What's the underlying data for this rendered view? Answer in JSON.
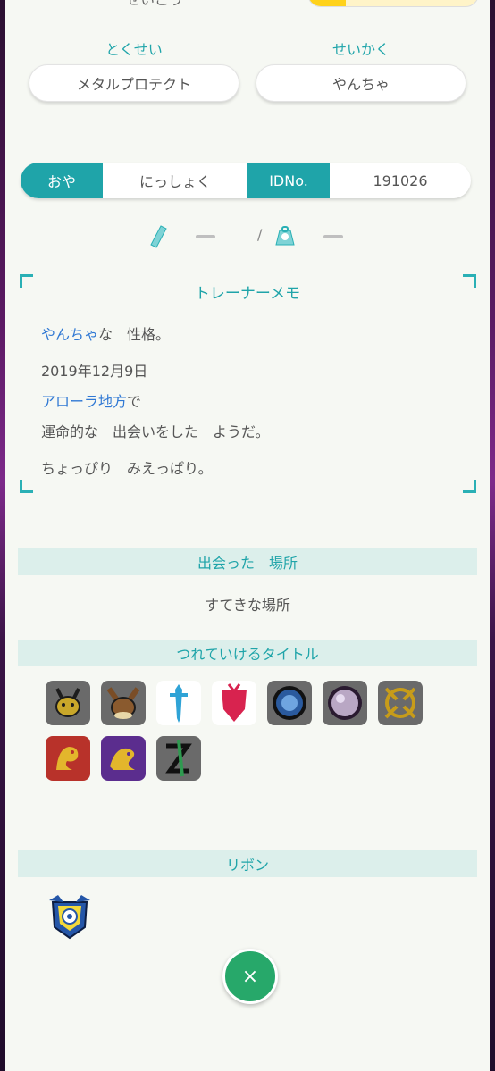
{
  "top": {
    "cut_label": "せいこう"
  },
  "ability": {
    "label": "とくせい",
    "value": "メタルプロテクト"
  },
  "nature": {
    "label": "せいかく",
    "value": "やんちゃ"
  },
  "trainer": {
    "ot_label": "おや",
    "ot_value": "にっしょく",
    "id_label": "IDNo.",
    "id_value": "191026"
  },
  "size": {
    "height": "—",
    "separator": "/",
    "weight": "—"
  },
  "memo": {
    "title": "トレーナーメモ",
    "nature_highlight": "やんちゃ",
    "nature_rest": "な　性格。",
    "date": "2019年12月9日",
    "region_highlight": "アローラ地方",
    "region_rest": "で",
    "met_line": "運命的な　出会いをした　ようだ。",
    "characteristic": "ちょっぴり　みえっぱり。"
  },
  "met_location": {
    "header": "出会った　場所",
    "value": "すてきな場所"
  },
  "titles": {
    "header": "つれていけるタイトル",
    "icons": [
      "pikachu-icon",
      "eevee-icon",
      "sword-icon",
      "shield-icon",
      "crystal-orb-icon",
      "pearl-orb-icon",
      "gold-emblem-icon",
      "red-dragon-icon",
      "purple-dragon-icon",
      "zeta-icon"
    ]
  },
  "ribbons": {
    "header": "リボン",
    "icons": [
      "champion-ribbon-icon"
    ]
  },
  "close_button": {
    "glyph": "×"
  },
  "colors": {
    "teal": "#1fa4a9",
    "blue_text": "#2f78d4",
    "close_green": "#27a86a"
  }
}
